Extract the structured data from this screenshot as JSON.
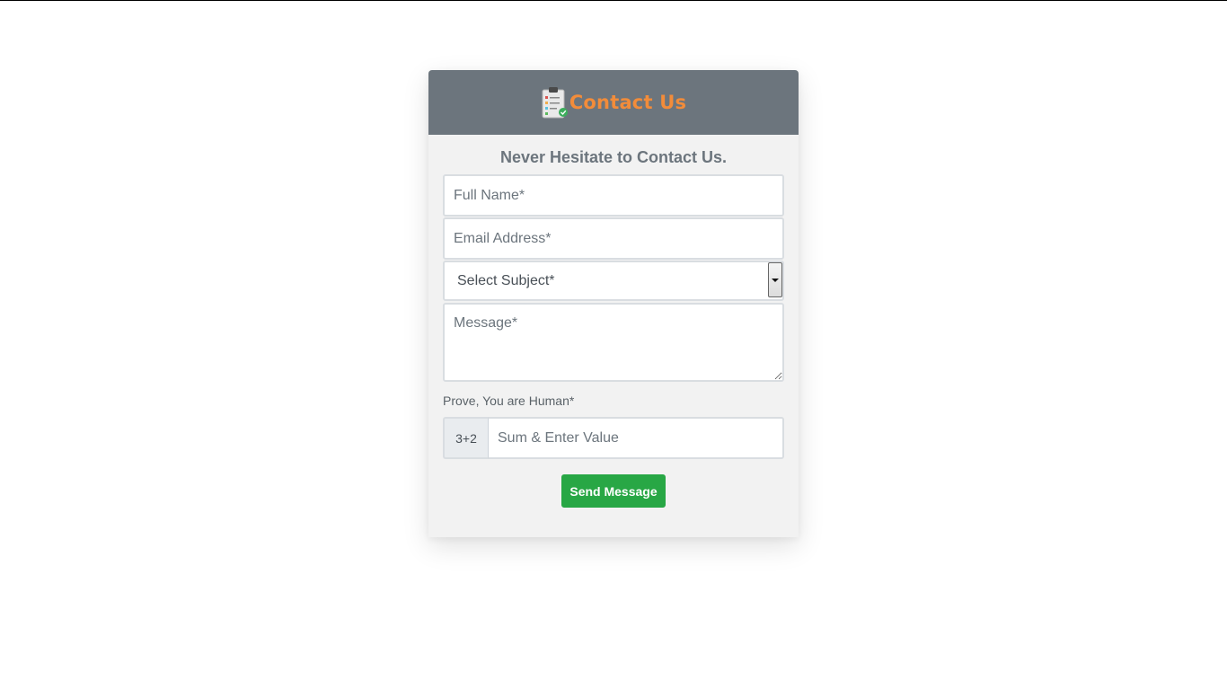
{
  "header": {
    "title": "Contact Us",
    "logo_icon": "clipboard-checklist-icon",
    "background_color": "#6c757d",
    "title_color": "#f28c3a"
  },
  "form": {
    "tagline": "Never Hesitate to Contact Us.",
    "full_name": {
      "placeholder": "Full Name*",
      "value": ""
    },
    "email": {
      "placeholder": "Email Address*",
      "value": ""
    },
    "subject": {
      "selected": "Select Subject*"
    },
    "message": {
      "placeholder": "Message*",
      "value": ""
    },
    "captcha": {
      "label": "Prove, You are Human*",
      "challenge": "3+2",
      "placeholder": "Sum & Enter Value",
      "value": ""
    },
    "submit_label": "Send Message",
    "submit_color": "#28a745"
  }
}
